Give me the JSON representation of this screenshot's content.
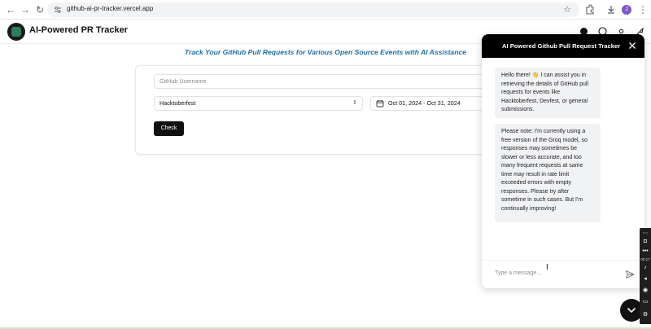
{
  "browser": {
    "url": "github-ai-pr-tracker.vercel.app",
    "profile_initial": "J"
  },
  "app": {
    "title": "AI-Powered PR Tracker",
    "tagline": "Track Your GitHub Pull Requests for Various Open Source Events with AI Assistance"
  },
  "form": {
    "username_placeholder": "GitHub Username",
    "event_value": "Hacktoberfest",
    "date_range": "Oct 01, 2024 - Oct 31, 2024",
    "check_label": "Check"
  },
  "chat": {
    "title": "AI Powered Github Pull Request Tracker",
    "messages": [
      "Hello there! 👋 I can assist you in retrieving the details of GitHub pull requests for events like Hacktoberfest, Devfest, or general submissions.",
      "Please note: I'm currently using a free version of the Groq model, so responses may sometimes be slower or less accurate, and too many frequent requests at same time may result in rate limit exceeded errors with empty responses. Please try after sometime in such cases. But I'm continually improving!"
    ],
    "input_placeholder": "Type a message..."
  },
  "recorder": {
    "time": "00:17"
  },
  "colors": {
    "tagline": "#1c6ea4",
    "chat_header": "#000000",
    "bubble_bg": "#f1f2f4",
    "button_bg": "#111111"
  }
}
